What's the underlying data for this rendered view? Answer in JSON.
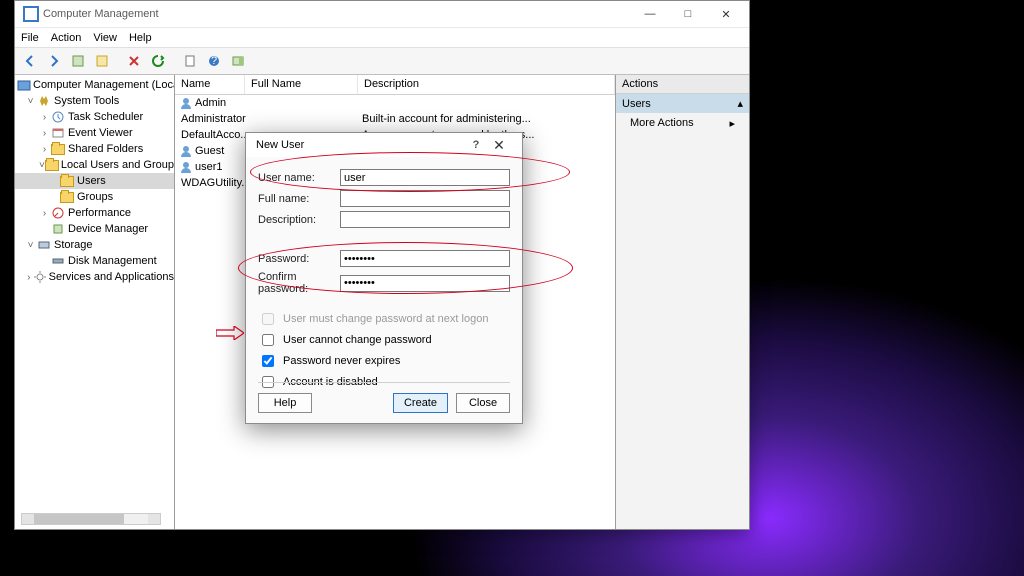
{
  "window": {
    "title": "Computer Management",
    "controls": {
      "min": "—",
      "max": "□",
      "close": "✕"
    }
  },
  "menubar": [
    "File",
    "Action",
    "View",
    "Help"
  ],
  "tree": {
    "root": "Computer Management (Local",
    "systools": "System Tools",
    "task": "Task Scheduler",
    "event": "Event Viewer",
    "shared": "Shared Folders",
    "lug": "Local Users and Groups",
    "users": "Users",
    "groups": "Groups",
    "perf": "Performance",
    "devmgr": "Device Manager",
    "storage": "Storage",
    "disk": "Disk Management",
    "services": "Services and Applications"
  },
  "list": {
    "columns": {
      "name": "Name",
      "fullname": "Full Name",
      "desc": "Description"
    },
    "rows": [
      {
        "name": "Admin",
        "fullname": "",
        "desc": ""
      },
      {
        "name": "Administrator",
        "fullname": "",
        "desc": "Built-in account for administering..."
      },
      {
        "name": "DefaultAcco...",
        "fullname": "",
        "desc": "A user account managed by the s..."
      },
      {
        "name": "Guest",
        "fullname": "",
        "desc": ""
      },
      {
        "name": "user1",
        "fullname": "",
        "desc": ""
      },
      {
        "name": "WDAGUtility...",
        "fullname": "",
        "desc": ""
      }
    ]
  },
  "actions": {
    "header": "Actions",
    "group": "Users",
    "more": "More Actions"
  },
  "dialog": {
    "title": "New User",
    "help": "?",
    "close": "✕",
    "username_label": "User name:",
    "username_value": "user",
    "fullname_label": "Full name:",
    "description_label": "Description:",
    "password_label": "Password:",
    "password_value": "••••••••",
    "confirm_label": "Confirm password:",
    "confirm_value": "••••••••",
    "chk_must": "User must change password at next logon",
    "chk_cannot": "User cannot change password",
    "chk_never": "Password never expires",
    "chk_disabled": "Account is disabled",
    "btn_help": "Help",
    "btn_create": "Create",
    "btn_close": "Close"
  }
}
